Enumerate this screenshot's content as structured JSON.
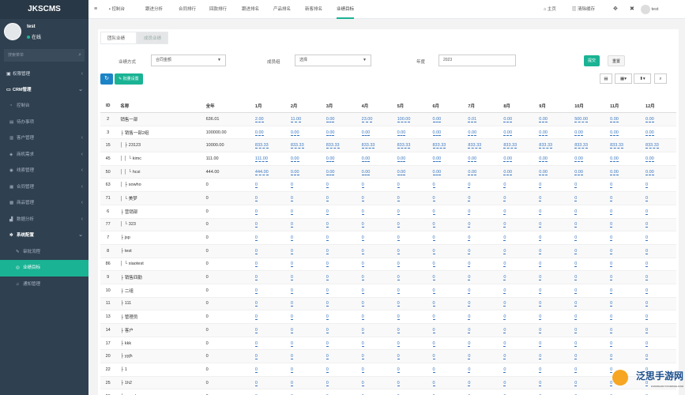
{
  "app": {
    "title": "JKSCMS"
  },
  "user": {
    "name": "test",
    "status": "在线"
  },
  "sidebar": {
    "search_placeholder": "搜索菜单",
    "items": [
      {
        "label": "权限管理",
        "icon": "lock-icon"
      },
      {
        "label": "CRM管理",
        "icon": "laptop-icon",
        "open": true
      }
    ],
    "subitems": [
      {
        "label": "控制台",
        "icon": "dashboard-icon"
      },
      {
        "label": "待办事项",
        "icon": "todo-icon"
      },
      {
        "label": "客户管理",
        "icon": "folder-icon",
        "arrow": true
      },
      {
        "label": "商机需求",
        "icon": "opportunity-icon",
        "arrow": true
      },
      {
        "label": "线索管理",
        "icon": "lead-icon",
        "arrow": true
      },
      {
        "label": "合同管理",
        "icon": "contract-icon",
        "arrow": true
      },
      {
        "label": "商品管理",
        "icon": "goods-icon",
        "arrow": true
      },
      {
        "label": "数据分析",
        "icon": "chart-icon",
        "arrow": true
      },
      {
        "label": "系统配置",
        "icon": "cogs-icon",
        "arrow": true,
        "open": true
      },
      {
        "label": "审批流程",
        "icon": "approval-icon"
      },
      {
        "label": "业绩目标",
        "icon": "target-icon",
        "active": true
      },
      {
        "label": "通知管理",
        "icon": "bell-icon"
      }
    ]
  },
  "topbar": {
    "menu_icon": "bars-icon",
    "tabs": [
      "控制台",
      "跟进分析",
      "合同排行",
      "回款排行",
      "跟进排名",
      "产品排名",
      "新客排名",
      "业绩目标"
    ],
    "right": {
      "home": "主页",
      "clear_cache": "清除缓存",
      "user": "test"
    }
  },
  "tabs": {
    "team": "团队业绩",
    "member": "成员业绩"
  },
  "filters": {
    "method_label": "业绩方式",
    "method_value": "合同金额",
    "member_label": "成员组",
    "member_value": "选择",
    "year_label": "年度",
    "year_value": "2023",
    "submit": "提交",
    "reset": "重置"
  },
  "toolbar": {
    "refresh_icon": "refresh-icon",
    "batch_label": "批量设置"
  },
  "table": {
    "headers": [
      "ID",
      "名称",
      "全年",
      "1月",
      "2月",
      "3月",
      "4月",
      "5月",
      "6月",
      "7月",
      "8月",
      "9月",
      "10月",
      "11月",
      "12月"
    ],
    "rows": [
      {
        "id": "2",
        "name": "销售一部",
        "year": "636.01",
        "months": [
          "2.00",
          "11.00",
          "0.00",
          "23.00",
          "100.00",
          "0.00",
          "0.01",
          "0.00",
          "0.00",
          "500.00",
          "0.00",
          "0.00"
        ]
      },
      {
        "id": "3",
        "name": "├ 销售一部2组",
        "year": "100000.00",
        "months": [
          "0.00",
          "0.00",
          "0.00",
          "0.00",
          "0.00",
          "0.00",
          "0.00",
          "0.00",
          "0.00",
          "0.00",
          "0.00",
          "0.00"
        ]
      },
      {
        "id": "15",
        "name": "│ ├ 23123",
        "year": "10000.00",
        "months": [
          "833.33",
          "833.33",
          "833.33",
          "833.33",
          "833.33",
          "833.33",
          "833.33",
          "833.33",
          "833.33",
          "833.33",
          "833.33",
          "833.33"
        ]
      },
      {
        "id": "45",
        "name": "│ │ └ kimc",
        "year": "111.00",
        "months": [
          "111.00",
          "0.00",
          "0.00",
          "0.00",
          "0.00",
          "0.00",
          "0.00",
          "0.00",
          "0.00",
          "0.00",
          "0.00",
          "0.00"
        ]
      },
      {
        "id": "50",
        "name": "│ │ └ hcsi",
        "year": "444.00",
        "months": [
          "444.00",
          "0.00",
          "0.00",
          "0.00",
          "0.00",
          "0.00",
          "0.00",
          "0.00",
          "0.00",
          "0.00",
          "0.00",
          "0.00"
        ]
      },
      {
        "id": "63",
        "name": "│ ├ sowho",
        "year": "0",
        "months": [
          "0",
          "0",
          "0",
          "0",
          "0",
          "0",
          "0",
          "0",
          "0",
          "0",
          "0",
          "0"
        ]
      },
      {
        "id": "71",
        "name": "│ └ 美梦",
        "year": "0",
        "months": [
          "0",
          "0",
          "0",
          "0",
          "0",
          "0",
          "0",
          "0",
          "0",
          "0",
          "0",
          "0"
        ]
      },
      {
        "id": "6",
        "name": "├ 营销部",
        "year": "0",
        "months": [
          "0",
          "0",
          "0",
          "0",
          "0",
          "0",
          "0",
          "0",
          "0",
          "0",
          "0",
          "0"
        ]
      },
      {
        "id": "77",
        "name": "│ └ 323",
        "year": "0",
        "months": [
          "0",
          "0",
          "0",
          "0",
          "0",
          "0",
          "0",
          "0",
          "0",
          "0",
          "0",
          "0"
        ]
      },
      {
        "id": "7",
        "name": "├ jsp",
        "year": "0",
        "months": [
          "0",
          "0",
          "0",
          "0",
          "0",
          "0",
          "0",
          "0",
          "0",
          "0",
          "0",
          "0"
        ]
      },
      {
        "id": "8",
        "name": "├ test",
        "year": "0",
        "months": [
          "0",
          "0",
          "0",
          "0",
          "0",
          "0",
          "0",
          "0",
          "0",
          "0",
          "0",
          "0"
        ]
      },
      {
        "id": "86",
        "name": "│ └ xiaotest",
        "year": "0",
        "months": [
          "0",
          "0",
          "0",
          "0",
          "0",
          "0",
          "0",
          "0",
          "0",
          "0",
          "0",
          "0"
        ]
      },
      {
        "id": "9",
        "name": "├ 销售四勤",
        "year": "0",
        "months": [
          "0",
          "0",
          "0",
          "0",
          "0",
          "0",
          "0",
          "0",
          "0",
          "0",
          "0",
          "0"
        ]
      },
      {
        "id": "10",
        "name": "├ 二组",
        "year": "0",
        "months": [
          "0",
          "0",
          "0",
          "0",
          "0",
          "0",
          "0",
          "0",
          "0",
          "0",
          "0",
          "0"
        ]
      },
      {
        "id": "11",
        "name": "├ 111",
        "year": "0",
        "months": [
          "0",
          "0",
          "0",
          "0",
          "0",
          "0",
          "0",
          "0",
          "0",
          "0",
          "0",
          "0"
        ]
      },
      {
        "id": "13",
        "name": "├ 管理员",
        "year": "0",
        "months": [
          "0",
          "0",
          "0",
          "0",
          "0",
          "0",
          "0",
          "0",
          "0",
          "0",
          "0",
          "0"
        ]
      },
      {
        "id": "14",
        "name": "├ 客户",
        "year": "0",
        "months": [
          "0",
          "0",
          "0",
          "0",
          "0",
          "0",
          "0",
          "0",
          "0",
          "0",
          "0",
          "0"
        ]
      },
      {
        "id": "17",
        "name": "├ kkk",
        "year": "0",
        "months": [
          "0",
          "0",
          "0",
          "0",
          "0",
          "0",
          "0",
          "0",
          "0",
          "0",
          "0",
          "0"
        ]
      },
      {
        "id": "20",
        "name": "├ yyjh",
        "year": "0",
        "months": [
          "0",
          "0",
          "0",
          "0",
          "0",
          "0",
          "0",
          "0",
          "0",
          "0",
          "0",
          "0"
        ]
      },
      {
        "id": "22",
        "name": "├ 1",
        "year": "0",
        "months": [
          "0",
          "0",
          "0",
          "0",
          "0",
          "0",
          "0",
          "0",
          "0",
          "0",
          "0",
          "0"
        ]
      },
      {
        "id": "25",
        "name": "├ 1h2",
        "year": "0",
        "months": [
          "0",
          "0",
          "0",
          "0",
          "0",
          "0",
          "0",
          "0",
          "0",
          "0",
          "0",
          "0"
        ]
      },
      {
        "id": "26",
        "name": "├ wanglong",
        "year": "0",
        "months": [
          "0",
          "0",
          "0",
          "0",
          "0",
          "0",
          "0",
          "0",
          "0",
          "0",
          "0",
          "0"
        ]
      }
    ]
  },
  "watermark": {
    "text": "泛思手游网",
    "sub": "FANSISHOUYOUWANG.COM"
  }
}
